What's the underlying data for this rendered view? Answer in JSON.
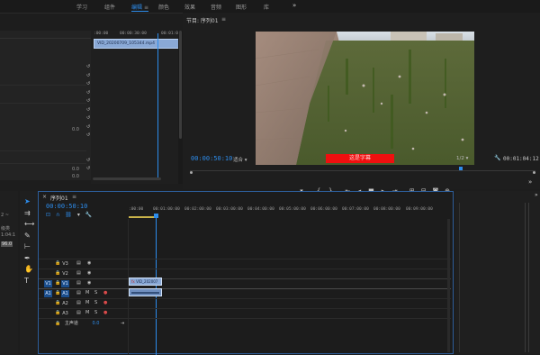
{
  "workspace_tabs": [
    "学习",
    "组件",
    "编辑",
    "颜色",
    "效果",
    "音频",
    "图形",
    "库"
  ],
  "active_tab_index": 2,
  "overflow": "»",
  "source": {
    "tc_start": ":00:00",
    "tc_mid": "00:00:30:00",
    "tc_end": "00:01:00",
    "clip_name": "VID_20200709_105344.mp4"
  },
  "program": {
    "title": "节目: 序列01",
    "menu": "≡",
    "timecode": "00:00:50:10",
    "fit": "适合",
    "quality": "1/2",
    "duration": "00:01:04:12",
    "subtitle": "这是字幕"
  },
  "timeline": {
    "close": "×",
    "title": "序列01",
    "menu": "≡",
    "timecode": "00:00:50:10",
    "ruler": [
      ":00:00",
      "00:01:00:00",
      "00:02:00:00",
      "00:03:00:00",
      "00:04:00:00",
      "00:05:00:00",
      "00:06:00:00",
      "00:07:00:00",
      "00:08:00:00",
      "00:09:00:00"
    ],
    "tracks": [
      {
        "name": "V3",
        "target": "",
        "type": "video"
      },
      {
        "name": "V2",
        "target": "",
        "type": "video"
      },
      {
        "name": "V1",
        "target": "V1",
        "type": "video"
      },
      {
        "name": "A1",
        "target": "A1",
        "type": "audio"
      },
      {
        "name": "A2",
        "target": "",
        "type": "audio"
      },
      {
        "name": "A3",
        "target": "",
        "type": "audio"
      }
    ],
    "master_label": "主声道",
    "master_value": "0.0",
    "clip_label": "VID_202007"
  },
  "left_panel": {
    "value_a": "0.0",
    "value_b": "0.0",
    "value_c": "0.0",
    "side_labels": [
      "2 ~",
      "级类",
      "1:04:1",
      "96.0"
    ]
  },
  "tools": [
    "select-icon",
    "track-select-icon",
    "ripple-icon",
    "razor-icon",
    "slip-icon",
    "pen-icon",
    "hand-icon",
    "type-icon"
  ]
}
